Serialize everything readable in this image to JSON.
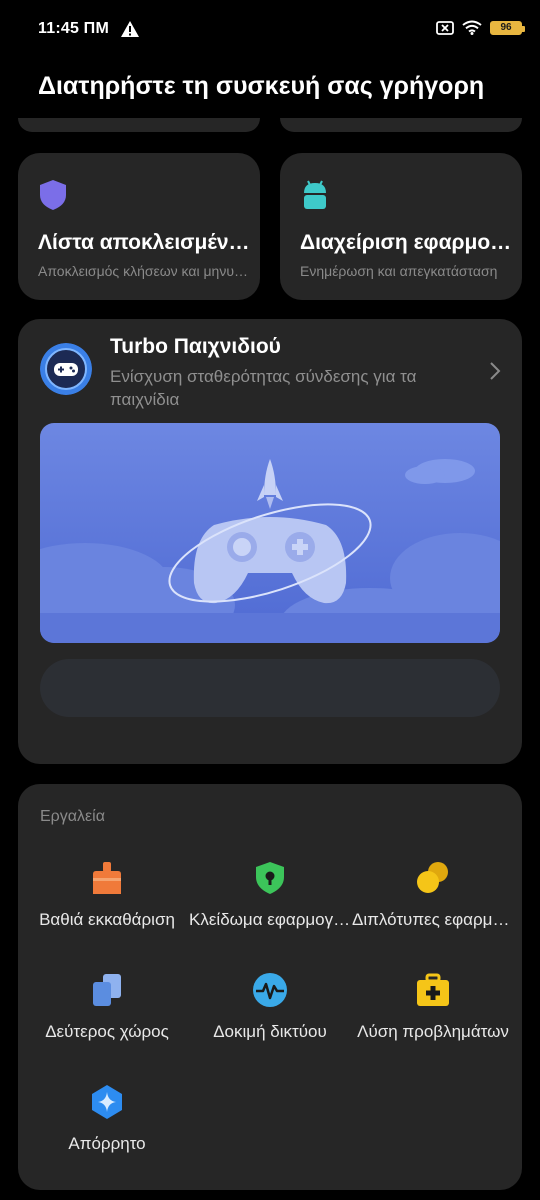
{
  "status_bar": {
    "time": "11:45 ΠΜ",
    "battery": "96"
  },
  "page": {
    "title": "Διατηρήστε τη συσκευή σας γρήγορη"
  },
  "feature_cards": [
    {
      "title": "Λίστα αποκλεισμένων",
      "subtitle": "Αποκλεισμός κλήσεων και μηνυμάτων",
      "icon": "shield-icon",
      "color": "#7b6ee8"
    },
    {
      "title": "Διαχείριση εφαρμογών",
      "subtitle": "Ενημέρωση και απεγκατάσταση",
      "icon": "android-icon",
      "color": "#3ec9c9"
    }
  ],
  "turbo": {
    "title": "Turbo Παιχνιδιού",
    "subtitle": "Ενίσχυση σταθερότητας σύνδεσης για τα παιχνίδια",
    "banner_color": "#5a78da"
  },
  "tools": {
    "header": "Εργαλεία",
    "items": [
      {
        "label": "Βαθιά εκκαθάριση",
        "icon": "broom-icon",
        "color": "#f07a3a"
      },
      {
        "label": "Κλείδωμα εφαρμογών",
        "icon": "lock-shield-icon",
        "color": "#3cc45a"
      },
      {
        "label": "Διπλότυπες εφαρμογές",
        "icon": "dual-apps-icon",
        "color": "#f5c518"
      },
      {
        "label": "Δεύτερος χώρος",
        "icon": "second-space-icon",
        "color": "#5b8de0"
      },
      {
        "label": "Δοκιμή δικτύου",
        "icon": "network-test-icon",
        "color": "#3aa9e8"
      },
      {
        "label": "Λύση προβλημάτων",
        "icon": "first-aid-icon",
        "color": "#f5c518"
      },
      {
        "label": "Απόρρητο",
        "icon": "privacy-icon",
        "color": "#2d8cf0"
      }
    ]
  }
}
